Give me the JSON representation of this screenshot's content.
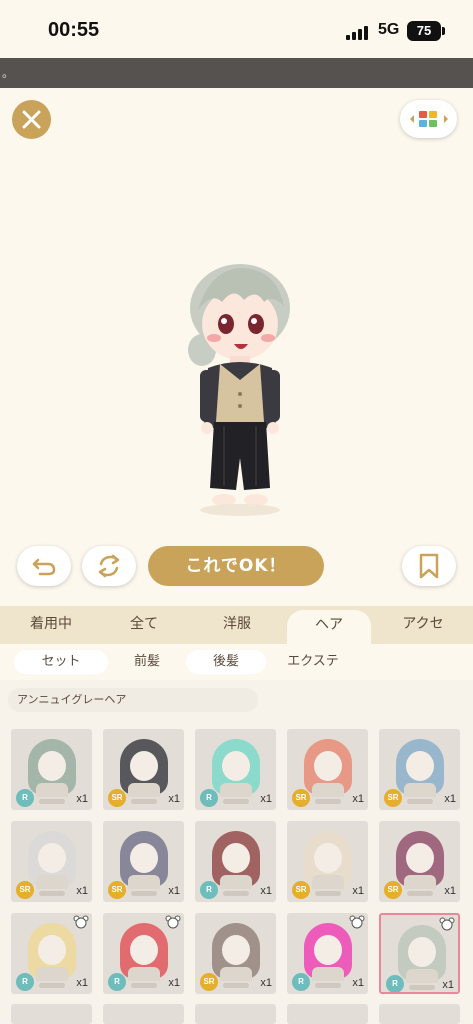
{
  "status": {
    "time": "00:55",
    "network": "5G",
    "battery": "75"
  },
  "ticker": {
    "text": "。"
  },
  "actions": {
    "ok_label": "これでOK！"
  },
  "tabs": [
    {
      "label": "着用中",
      "active": false
    },
    {
      "label": "全て",
      "active": false
    },
    {
      "label": "洋服",
      "active": false
    },
    {
      "label": "ヘア",
      "active": true
    },
    {
      "label": "アクセ",
      "active": false
    }
  ],
  "subtabs": [
    {
      "label": "セット",
      "active": false
    },
    {
      "label": "前髪",
      "active": true
    },
    {
      "label": "後髪",
      "active": false
    },
    {
      "label": "エクステ",
      "active": false
    }
  ],
  "selected_item_name": "アンニュイグレーヘア",
  "items": [
    {
      "rarity": "R",
      "count": "x1",
      "hair_color": "#8fa89a"
    },
    {
      "rarity": "SR",
      "count": "x1",
      "hair_color": "#2a2a33"
    },
    {
      "rarity": "R",
      "count": "x1",
      "hair_color": "#6fd8c8"
    },
    {
      "rarity": "SR",
      "count": "x1",
      "hair_color": "#e9826a"
    },
    {
      "rarity": "SR",
      "count": "x1",
      "hair_color": "#7fa9c9"
    },
    {
      "rarity": "SR",
      "count": "x1",
      "hair_color": "#d8d8d8"
    },
    {
      "rarity": "SR",
      "count": "x1",
      "hair_color": "#6a6a86"
    },
    {
      "rarity": "R",
      "count": "x1",
      "hair_color": "#8a3a3a"
    },
    {
      "rarity": "SR",
      "count": "x1",
      "hair_color": "#eadcc8"
    },
    {
      "rarity": "SR",
      "count": "x1",
      "hair_color": "#8a4060"
    },
    {
      "rarity": "R",
      "count": "x1",
      "hair_color": "#f0d890"
    },
    {
      "rarity": "R",
      "count": "x1",
      "hair_color": "#e0444c"
    },
    {
      "rarity": "SR",
      "count": "x1",
      "hair_color": "#8a7870"
    },
    {
      "rarity": "R",
      "count": "x1",
      "hair_color": "#f030b0"
    },
    {
      "rarity": "R",
      "count": "x1",
      "hair_color": "#b8c4b8"
    }
  ],
  "icons": {
    "close": "close-icon",
    "grid": "color-grid-icon",
    "undo": "undo-icon",
    "redo": "refresh-icon",
    "bookmark": "bookmark-icon",
    "bear": "bear-badge-icon"
  },
  "colors": {
    "accent_gold": "#c9a35a",
    "selected_border": "#e8889a",
    "rarity_r": "#6fbcbc",
    "rarity_sr": "#e5ae2c"
  }
}
